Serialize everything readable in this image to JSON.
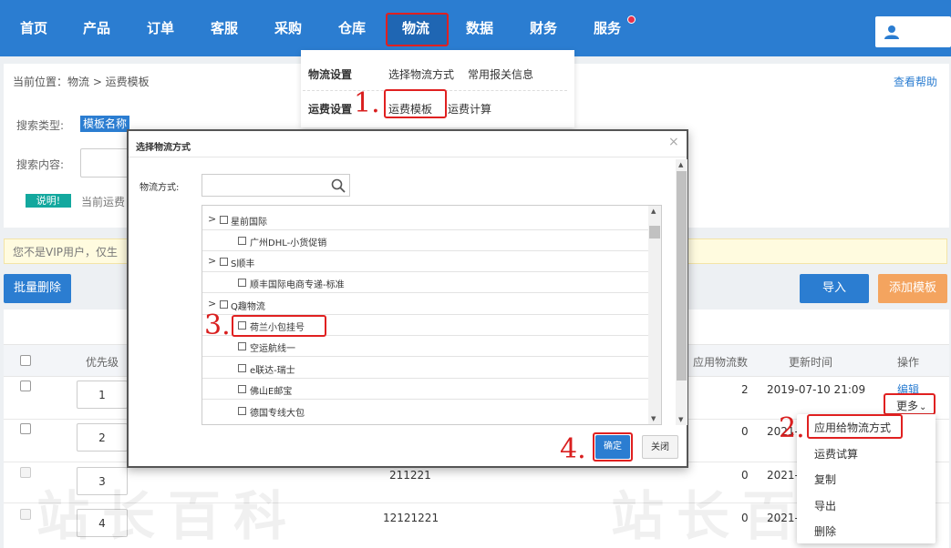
{
  "topnav": {
    "items": [
      "首页",
      "产品",
      "订单",
      "客服",
      "采购",
      "仓库",
      "物流",
      "数据",
      "财务",
      "服务"
    ],
    "active": "物流",
    "accent": "#2b7dd1"
  },
  "logistics_menu": {
    "group1_title": "物流设置",
    "group1_items": [
      "选择物流方式",
      "常用报关信息"
    ],
    "group2_title": "运费设置",
    "group2_items": [
      "运费模板",
      "运费计算"
    ]
  },
  "page": {
    "breadcrumb": "当前位置：物流 > 运费模板",
    "help": "查看帮助",
    "search_type_label": "搜索类型:",
    "search_type_value": "模板名称",
    "search_content_label": "搜索内容:",
    "note_tag": "说明!",
    "note_text": "当前运费",
    "vip_notice": "您不是VIP用户，仅生",
    "bulk_delete": "批量删除",
    "import": "导入",
    "add_template": "添加模板"
  },
  "table": {
    "headers": {
      "priority": "优先级",
      "count": "应用物流数",
      "updated": "更新时间",
      "actions": "操作"
    },
    "rows": [
      {
        "priority": "1",
        "name": "",
        "count": "2",
        "updated": "2019-07-10 21:09"
      },
      {
        "priority": "2",
        "name": "",
        "count": "0",
        "updated": "2021-"
      },
      {
        "priority": "3",
        "name": "211221",
        "count": "0",
        "updated": "2021-0"
      },
      {
        "priority": "4",
        "name": "12121221",
        "count": "0",
        "updated": "2021-0"
      }
    ],
    "edit": "编辑",
    "more": "更多",
    "more_menu": [
      "应用给物流方式",
      "运费试算",
      "复制",
      "导出",
      "删除"
    ]
  },
  "dialog": {
    "title": "选择物流方式",
    "close": "×",
    "field_label": "物流方式:",
    "items": [
      {
        "label": "星前国际",
        "group": true
      },
      {
        "label": "广州DHL-小货促销",
        "group": false
      },
      {
        "label": "S顺丰",
        "group": true
      },
      {
        "label": "顺丰国际电商专递-标准",
        "group": false
      },
      {
        "label": "Q趣物流",
        "group": true
      },
      {
        "label": "荷兰小包挂号",
        "group": false
      },
      {
        "label": "空运航线一",
        "group": false
      },
      {
        "label": "e联达-瑞士",
        "group": false
      },
      {
        "label": "佛山E邮宝",
        "group": false
      },
      {
        "label": "德国专线大包",
        "group": false
      }
    ],
    "confirm": "确定",
    "cancel": "关闭"
  },
  "annotations": {
    "step1": "1.",
    "step2": "2.",
    "step3": "3.",
    "step4": "4."
  },
  "watermark": "站长百科"
}
